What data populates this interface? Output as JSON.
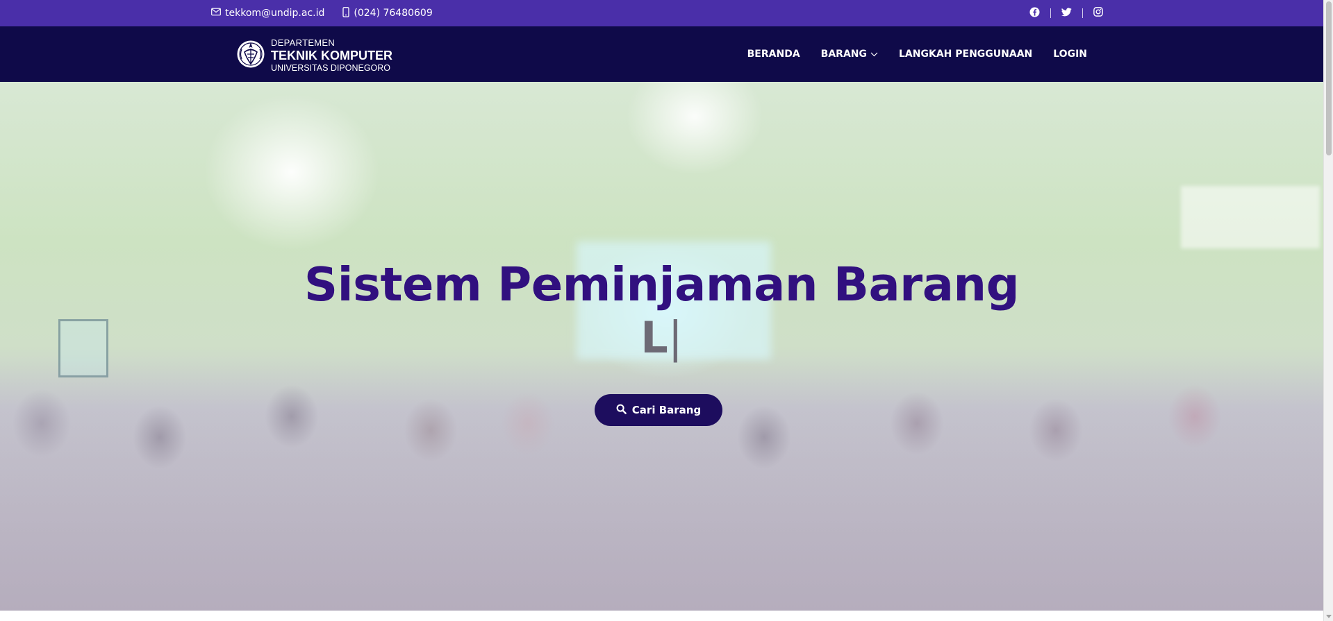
{
  "topbar": {
    "email": "tekkom@undip.ac.id",
    "phone": "(024) 76480609",
    "icons": {
      "email": "envelope-icon",
      "phone": "phone-icon",
      "social": [
        "facebook-icon",
        "twitter-icon",
        "instagram-icon"
      ]
    }
  },
  "brand": {
    "line1": "DEPARTEMEN",
    "line2": "TEKNIK KOMPUTER",
    "line3": "UNIVERSITAS DIPONEGORO",
    "logo_icon": "undip-seal-logo"
  },
  "nav": {
    "items": [
      {
        "label": "BERANDA"
      },
      {
        "label": "BARANG",
        "icon": "chevron-down-icon"
      },
      {
        "label": "LANGKAH PENGGUNAAN"
      },
      {
        "label": "LOGIN"
      }
    ]
  },
  "hero": {
    "title": "Sistem Peminjaman Barang",
    "typed_text": "L",
    "cursor": "|",
    "cta_label": "Cari Barang",
    "cta_icon": "search-icon"
  },
  "colors": {
    "topbar_bg": "#4a2fa9",
    "header_bg": "#0f0a49",
    "title": "#31107f",
    "cta_bg": "#1d0d5e"
  }
}
